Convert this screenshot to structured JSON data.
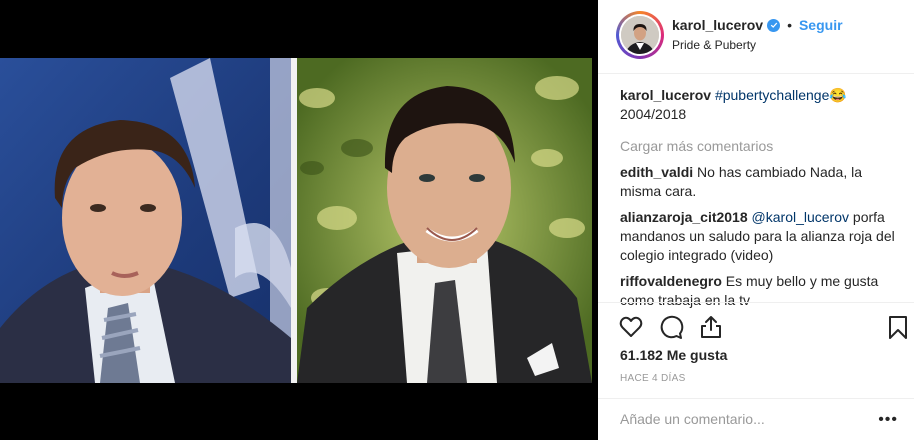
{
  "post": {
    "username": "karol_lucerov",
    "follow_label": "Seguir",
    "separator": "•",
    "location": "Pride & Puberty"
  },
  "caption": {
    "username": "karol_lucerov",
    "hashtag": "#pubertychallenge",
    "emoji": "😂",
    "text": "2004/2018"
  },
  "load_more_label": "Cargar más comentarios",
  "comments": [
    {
      "username": "edith_valdi",
      "text": "No has cambiado Nada, la misma cara."
    },
    {
      "username": "alianzaroja_cit2018",
      "mention": "@karol_lucerov",
      "text": "porfa mandanos un saludo para la alianza roja del colegio integrado (video)"
    },
    {
      "username": "riffovaldenegro",
      "text": "Es muy bello y me gusta como trabaja en la tv"
    }
  ],
  "actions": {
    "icons": [
      "heart-icon",
      "comment-icon",
      "share-icon",
      "bookmark-icon"
    ]
  },
  "likes": "61.182 Me gusta",
  "timestamp": "HACE 4 DÍAS",
  "comment_box": {
    "placeholder": "Añade un comentario...",
    "more": "•••"
  },
  "colors": {
    "link_blue": "#3897f0",
    "hashtag_blue": "#003569",
    "muted_gray": "#999999",
    "text_dark": "#262626"
  }
}
